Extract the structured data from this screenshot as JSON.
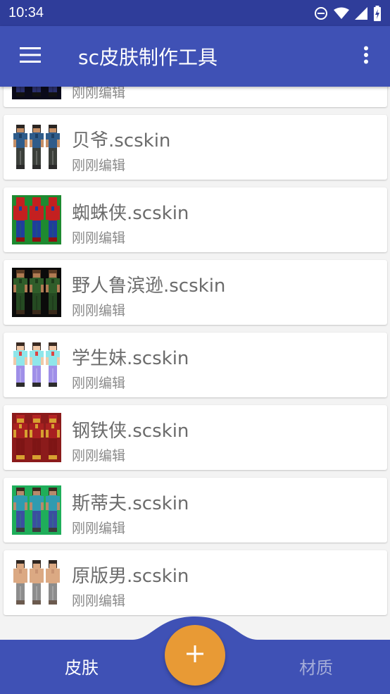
{
  "status_bar": {
    "time": "10:34"
  },
  "app_bar": {
    "title": "sc皮肤制作工具"
  },
  "skins": [
    {
      "name": "",
      "subtitle": "刚刚编辑",
      "thumb": "dark"
    },
    {
      "name": "贝爷.scskin",
      "subtitle": "刚刚编辑",
      "thumb": "beiye"
    },
    {
      "name": "蜘蛛侠.scskin",
      "subtitle": "刚刚编辑",
      "thumb": "spider"
    },
    {
      "name": "野人鲁滨逊.scskin",
      "subtitle": "刚刚编辑",
      "thumb": "wild"
    },
    {
      "name": "学生妹.scskin",
      "subtitle": "刚刚编辑",
      "thumb": "student"
    },
    {
      "name": "钢铁侠.scskin",
      "subtitle": "刚刚编辑",
      "thumb": "iron"
    },
    {
      "name": "斯蒂夫.scskin",
      "subtitle": "刚刚编辑",
      "thumb": "steve"
    },
    {
      "name": "原版男.scskin",
      "subtitle": "刚刚编辑",
      "thumb": "original"
    }
  ],
  "bottom_nav": {
    "tabs": [
      {
        "label": "皮肤",
        "active": true
      },
      {
        "label": "材质",
        "active": false
      }
    ],
    "fab_icon": "plus-icon"
  },
  "colors": {
    "status_bar": "#2f3d9a",
    "app_bar": "#3f51b5",
    "fab": "#e89a35",
    "tab_active": "#ffffff",
    "tab_inactive": "#a4acd8"
  }
}
